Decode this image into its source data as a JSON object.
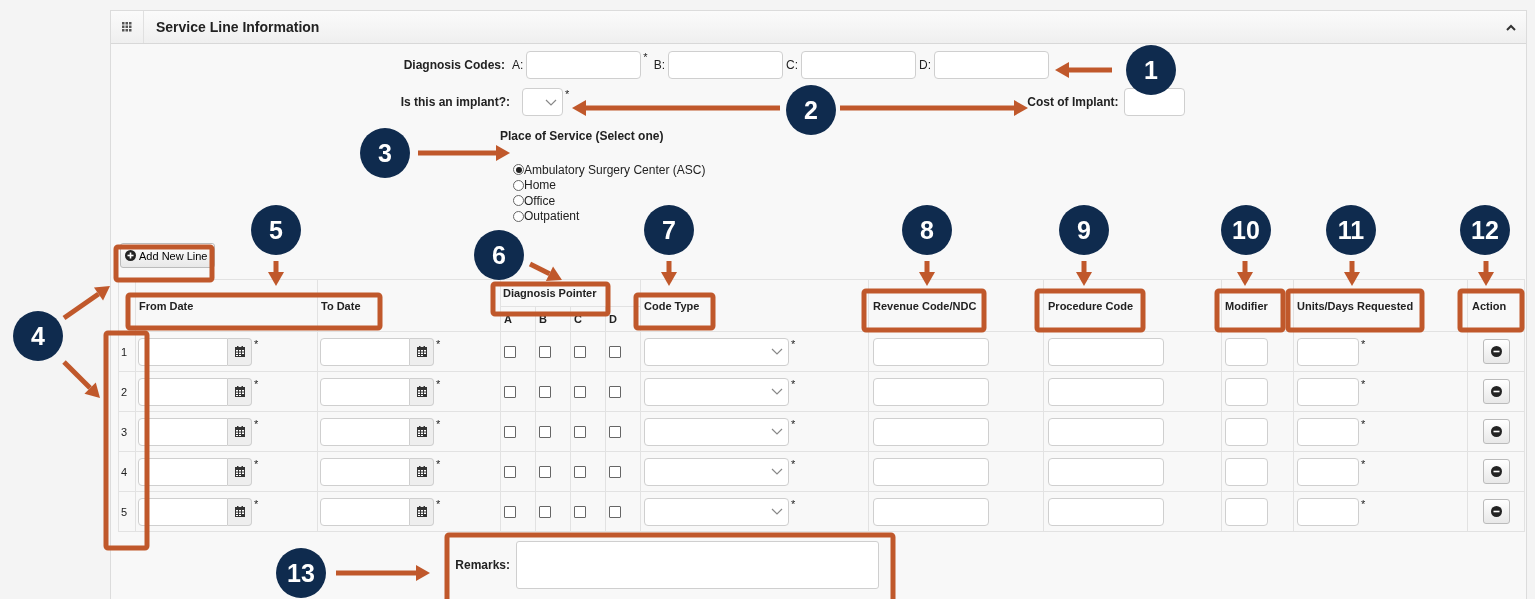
{
  "panel": {
    "title": "Service Line Information",
    "expanded": true
  },
  "diagnosis_codes": {
    "label": "Diagnosis Codes:",
    "fields": [
      {
        "letter": "A:",
        "required": "*"
      },
      {
        "letter": "B:"
      },
      {
        "letter": "C:"
      },
      {
        "letter": "D:"
      }
    ]
  },
  "implant": {
    "label": "Is this an implant?:",
    "required": "*"
  },
  "cost_of_implant": {
    "label": "Cost of Implant:"
  },
  "place_of_service": {
    "title": "Place of Service (Select one)",
    "options": [
      {
        "label": "Ambulatory Surgery Center (ASC)",
        "selected": true
      },
      {
        "label": "Home",
        "selected": false
      },
      {
        "label": "Office",
        "selected": false
      },
      {
        "label": "Outpatient",
        "selected": false
      }
    ]
  },
  "add_line_button": "Add New Line",
  "table": {
    "columns": {
      "from_date": "From Date",
      "to_date": "To Date",
      "diagnosis_pointer": "Diagnosis Pointer",
      "pointer_letters": [
        "A",
        "B",
        "C",
        "D"
      ],
      "code_type": "Code Type",
      "revenue_code": "Revenue Code/NDC",
      "procedure_code": "Procedure Code",
      "modifier": "Modifier",
      "units": "Units/Days Requested",
      "action": "Action"
    },
    "rows": [
      {
        "number": "1",
        "from_required": "*",
        "to_required": "*",
        "pointers": [
          {
            "checked": false
          },
          {
            "checked": false
          },
          {
            "checked": false
          },
          {
            "checked": false
          }
        ],
        "code_type_required": "*",
        "units_required": "*"
      },
      {
        "number": "2",
        "from_required": "*",
        "to_required": "*",
        "pointers": [
          {
            "checked": false
          },
          {
            "checked": false
          },
          {
            "checked": false
          },
          {
            "checked": false
          }
        ],
        "code_type_required": "*",
        "units_required": "*"
      },
      {
        "number": "3",
        "from_required": "*",
        "to_required": "*",
        "pointers": [
          {
            "checked": false
          },
          {
            "checked": false
          },
          {
            "checked": false
          },
          {
            "checked": false
          }
        ],
        "code_type_required": "*",
        "units_required": "*"
      },
      {
        "number": "4",
        "from_required": "*",
        "to_required": "*",
        "pointers": [
          {
            "checked": false
          },
          {
            "checked": false
          },
          {
            "checked": false
          },
          {
            "checked": false
          }
        ],
        "code_type_required": "*",
        "units_required": "*"
      },
      {
        "number": "5",
        "from_required": "*",
        "to_required": "*",
        "pointers": [
          {
            "checked": false
          },
          {
            "checked": false
          },
          {
            "checked": false
          },
          {
            "checked": false
          }
        ],
        "code_type_required": "*",
        "units_required": "*"
      }
    ]
  },
  "remarks": {
    "label": "Remarks:"
  },
  "callouts": [
    "1",
    "2",
    "3",
    "4",
    "5",
    "6",
    "7",
    "8",
    "9",
    "10",
    "11",
    "12",
    "13"
  ]
}
